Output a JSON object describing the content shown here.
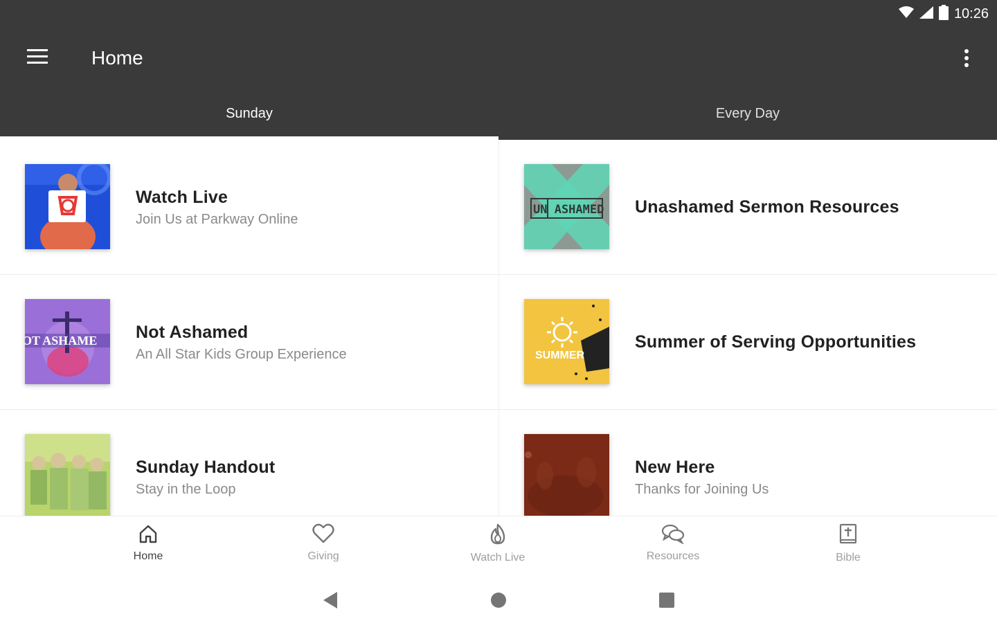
{
  "status_bar": {
    "time": "10:26",
    "icons": [
      "wifi-icon",
      "signal-icon",
      "battery-icon"
    ]
  },
  "app_bar": {
    "title": "Home",
    "menu_icon": "hamburger-menu-icon",
    "overflow_icon": "more-vertical-icon"
  },
  "tabs": [
    {
      "label": "Sunday",
      "active": true
    },
    {
      "label": "Every Day",
      "active": false
    }
  ],
  "left_items": [
    {
      "title": "Watch Live",
      "subtitle": "Join Us at Parkway Online",
      "thumb": "watch-live-thumbnail"
    },
    {
      "title": "Not Ashamed",
      "subtitle": "An All Star Kids Group Experience",
      "thumb": "not-ashamed-thumbnail",
      "thumb_text": "OT ASHAME"
    },
    {
      "title": "Sunday Handout",
      "subtitle": "Stay in the Loop",
      "thumb": "sunday-handout-thumbnail"
    }
  ],
  "right_items": [
    {
      "title": "Unashamed Sermon Resources",
      "subtitle": "",
      "thumb": "unashamed-thumbnail",
      "thumb_text": "UN ASHAMED"
    },
    {
      "title": "Summer of Serving Opportunities",
      "subtitle": "",
      "thumb": "summer-serving-thumbnail",
      "thumb_text": "SUMMER"
    },
    {
      "title": "New Here",
      "subtitle": "Thanks for Joining Us",
      "thumb": "new-here-thumbnail"
    }
  ],
  "bottom_nav": [
    {
      "label": "Home",
      "icon": "home-icon",
      "active": true
    },
    {
      "label": "Giving",
      "icon": "heart-icon",
      "active": false
    },
    {
      "label": "Watch Live",
      "icon": "flame-icon",
      "active": false
    },
    {
      "label": "Resources",
      "icon": "chat-bubbles-icon",
      "active": false
    },
    {
      "label": "Bible",
      "icon": "bible-icon",
      "active": false
    }
  ],
  "system_nav": [
    "back-icon",
    "home-circle-icon",
    "recents-icon"
  ],
  "colors": {
    "toolbar": "#3a3a3a",
    "active_tab_indicator": "#ffffff",
    "title_text": "#212121",
    "subtitle_text": "#8a8a8a",
    "nav_inactive": "#9e9e9e"
  }
}
